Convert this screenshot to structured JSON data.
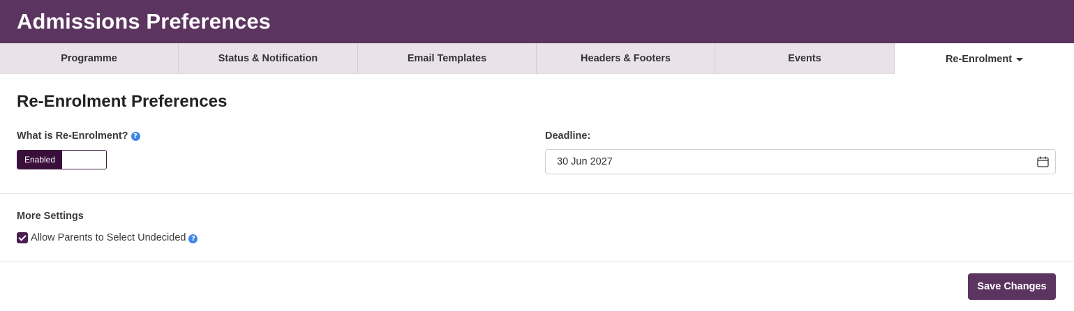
{
  "header": {
    "title": "Admissions Preferences"
  },
  "tabs": [
    {
      "label": "Programme"
    },
    {
      "label": "Status & Notification"
    },
    {
      "label": "Email Templates"
    },
    {
      "label": "Headers & Footers"
    },
    {
      "label": "Events"
    },
    {
      "label": "Re-Enrolment",
      "active": true
    }
  ],
  "section": {
    "title": "Re-Enrolment Preferences"
  },
  "reenrolment": {
    "label": "What is Re-Enrolment?",
    "toggle_state": "Enabled",
    "help_icon": "question-circle-icon"
  },
  "deadline": {
    "label": "Deadline:",
    "value": "30 Jun 2027",
    "icon": "calendar-icon"
  },
  "more_settings": {
    "label": "More Settings",
    "allow_undecided_label": "Allow Parents to Select Undecided",
    "allow_undecided_checked": true
  },
  "actions": {
    "save_label": "Save Changes"
  },
  "colors": {
    "brand": "#5c3460",
    "toggle_on": "#3a0f3c",
    "tab_bg": "#e9e2e9",
    "help_icon": "#3d86e6"
  }
}
